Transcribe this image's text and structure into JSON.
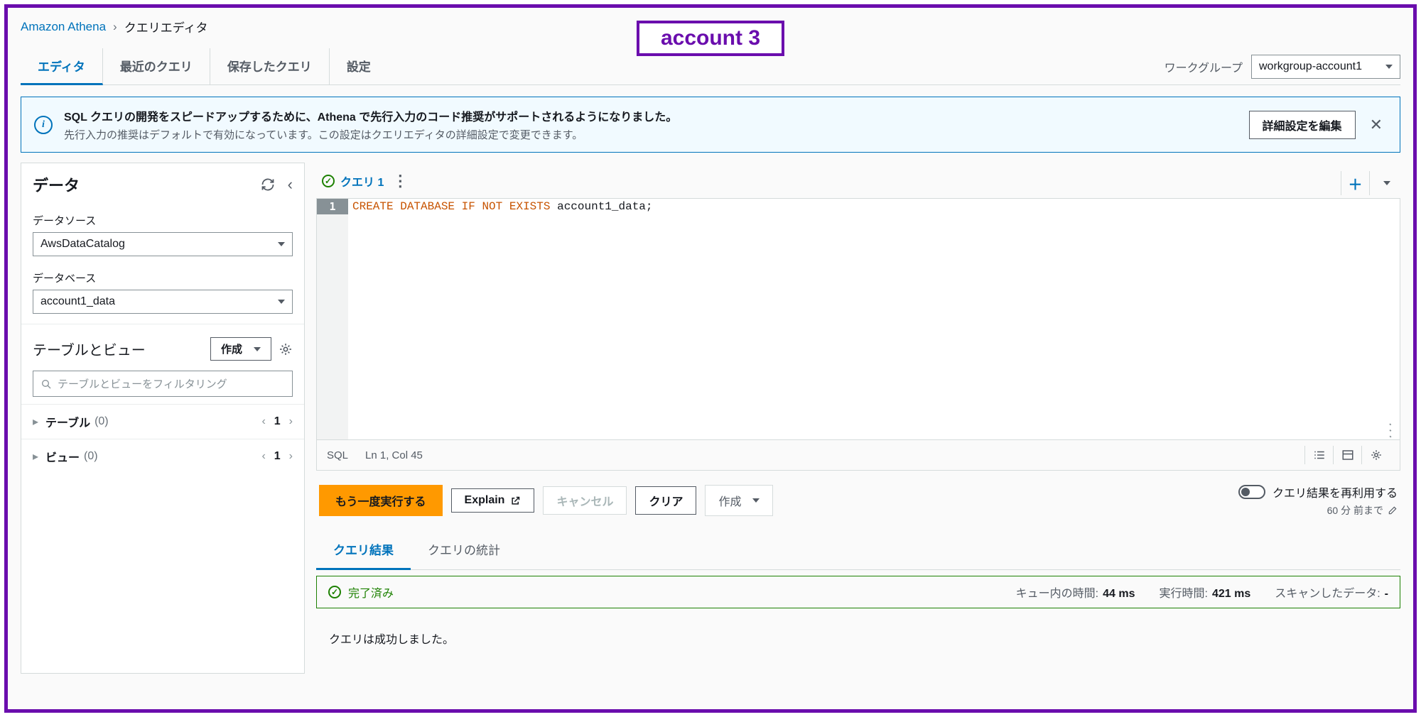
{
  "account_badge": "account 3",
  "breadcrumb": {
    "root": "Amazon Athena",
    "sep": "›",
    "current": "クエリエディタ"
  },
  "tabs": {
    "editor": "エディタ",
    "recent": "最近のクエリ",
    "saved": "保存したクエリ",
    "settings": "設定"
  },
  "workgroup": {
    "label": "ワークグループ",
    "value": "workgroup-account1"
  },
  "banner": {
    "title": "SQL クエリの開発をスピードアップするために、Athena で先行入力のコード推奨がサポートされるようになりました。",
    "desc": "先行入力の推奨はデフォルトで有効になっています。この設定はクエリエディタの詳細設定で変更できます。",
    "edit_button": "詳細設定を編集"
  },
  "sidebar": {
    "title": "データ",
    "datasource_label": "データソース",
    "datasource_value": "AwsDataCatalog",
    "database_label": "データベース",
    "database_value": "account1_data",
    "tv_title": "テーブルとビュー",
    "create_button": "作成",
    "filter_placeholder": "テーブルとビューをフィルタリング",
    "tables_label": "テーブル",
    "tables_count": "(0)",
    "views_label": "ビュー",
    "views_count": "(0)",
    "page": "1"
  },
  "editor": {
    "tab_label": "クエリ 1",
    "line_number": "1",
    "code_kw1": "CREATE",
    "code_kw2": "DATABASE",
    "code_kw3": "IF",
    "code_kw4": "NOT",
    "code_kw5": "EXISTS",
    "code_ident": " account1_data;",
    "status_lang": "SQL",
    "status_pos": "Ln 1, Col 45"
  },
  "actions": {
    "run_again": "もう一度実行する",
    "explain": "Explain",
    "cancel": "キャンセル",
    "clear": "クリア",
    "create": "作成",
    "reuse_label": "クエリ結果を再利用する",
    "reuse_note": "60 分 前まで"
  },
  "results": {
    "tab_results": "クエリ結果",
    "tab_stats": "クエリの統計",
    "status_label": "完了済み",
    "queue_label": "キュー内の時間:",
    "queue_value": "44 ms",
    "exec_label": "実行時間:",
    "exec_value": "421 ms",
    "scan_label": "スキャンしたデータ:",
    "scan_value": "-",
    "message": "クエリは成功しました。"
  }
}
